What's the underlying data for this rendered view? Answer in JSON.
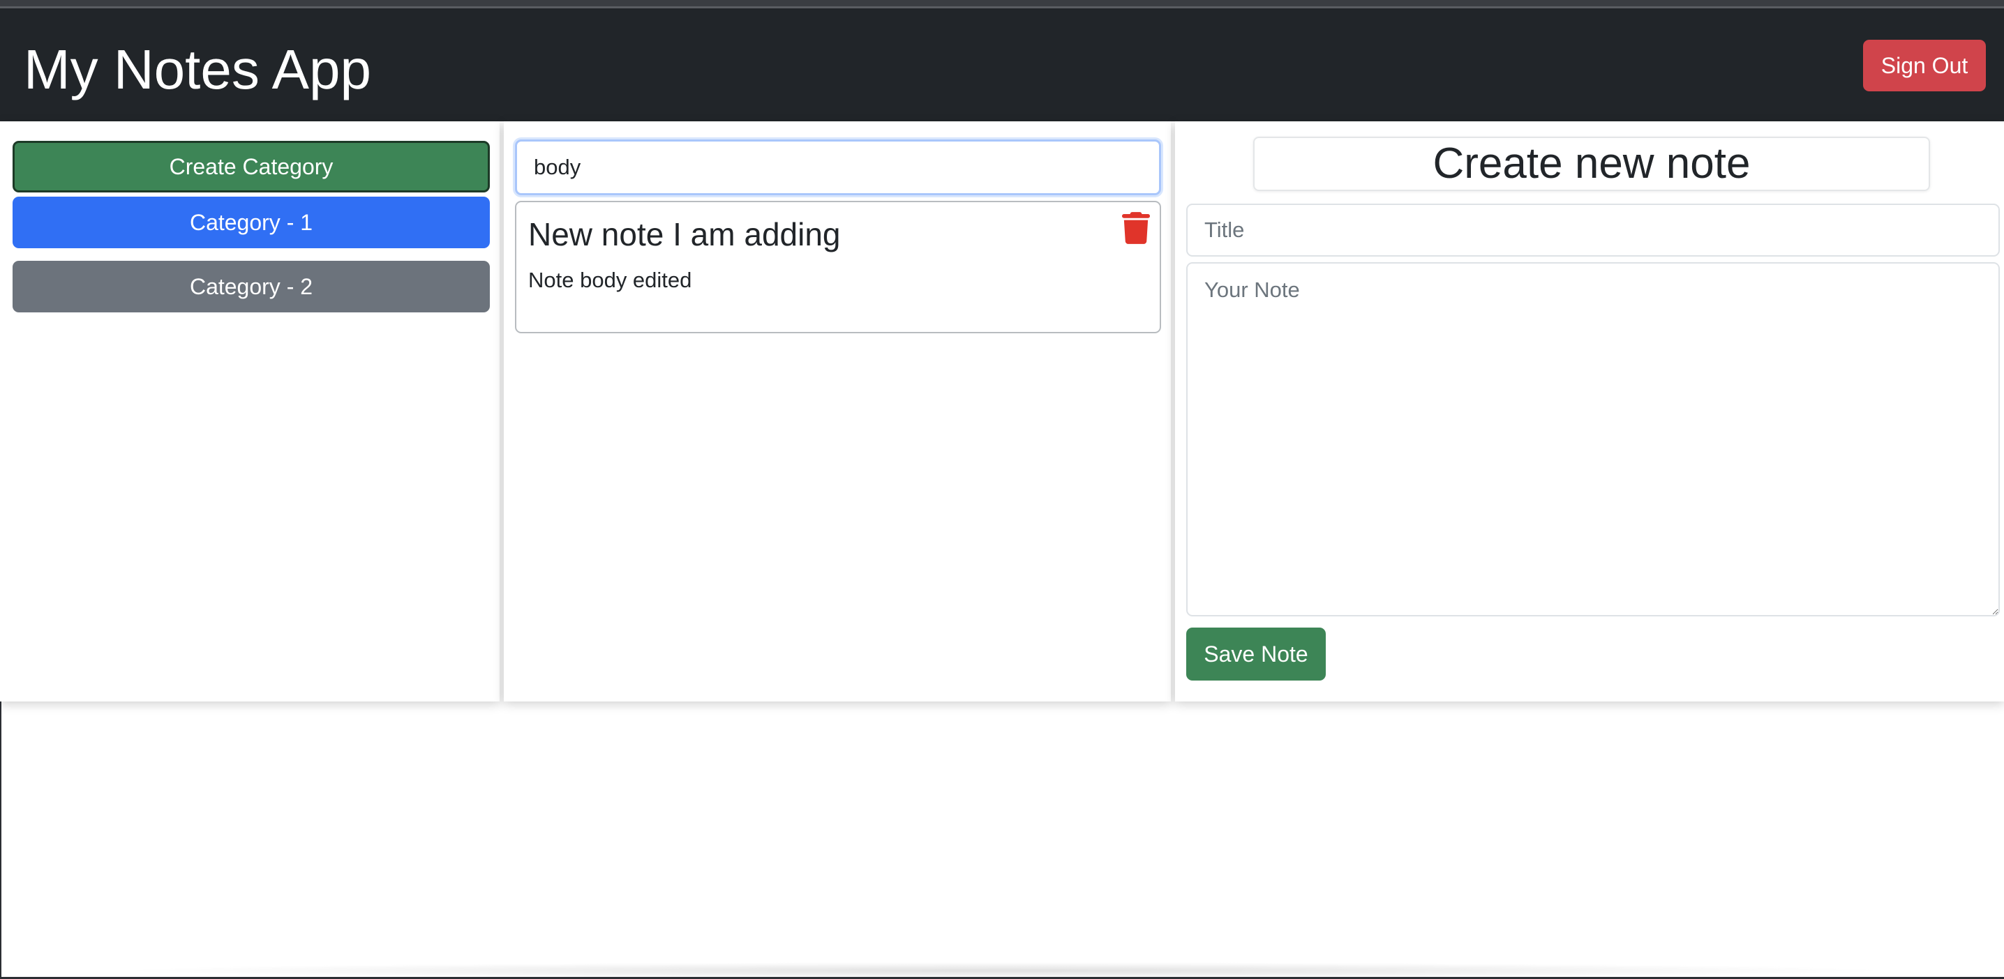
{
  "app": {
    "title": "My Notes App",
    "sign_out_label": "Sign Out"
  },
  "categories": {
    "create_label": "Create Category",
    "items": [
      {
        "label": "Category - 1",
        "state": "active",
        "color": "#306ff4"
      },
      {
        "label": "Category - 2",
        "state": "inactive",
        "color": "#6c737c"
      }
    ]
  },
  "notes_list": {
    "search_value": "body",
    "notes": [
      {
        "title": "New note I am adding",
        "body": "Note body edited",
        "delete_icon": "trash-icon"
      }
    ]
  },
  "editor": {
    "heading": "Create new note",
    "title_placeholder": "Title",
    "note_placeholder": "Your Note",
    "save_label": "Save Note"
  },
  "colors": {
    "navbar": "#212529",
    "danger": "#d0444b",
    "success": "#3d8556",
    "primary": "#306ff4",
    "secondary": "#6c737c"
  }
}
